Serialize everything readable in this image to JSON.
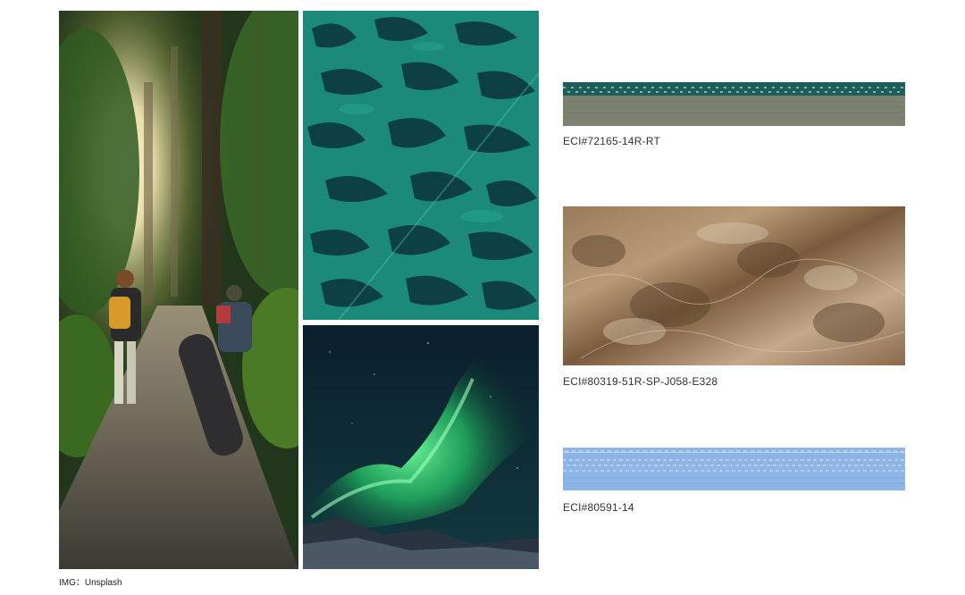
{
  "credit": "IMG：Unsplash",
  "swatches": [
    {
      "code": "ECI#72165-14R-RT",
      "image": "teal-and-grey-stitched-trim"
    },
    {
      "code": "ECI#80319-51R-SP-J058-E328",
      "image": "marble-print-mesh-fabric"
    },
    {
      "code": "ECI#80591-14",
      "image": "light-blue-elastic-trim"
    }
  ],
  "photos": [
    {
      "image": "forest-hikers-photo"
    },
    {
      "image": "green-lace-fabric-closeup"
    },
    {
      "image": "northern-lights-photo"
    }
  ],
  "colors": {
    "forest_green": "#2f4a22",
    "lace_teal": "#1e8f80",
    "lace_dark": "#0c3a44",
    "aurora_green": "#35d878",
    "aurora_sky": "#0a2233",
    "trim1_teal": "#1d5e5a",
    "trim1_grey": "#7b8270",
    "marble_brown": "#8a6a4c",
    "elastic_blue": "#8fb5e6"
  }
}
